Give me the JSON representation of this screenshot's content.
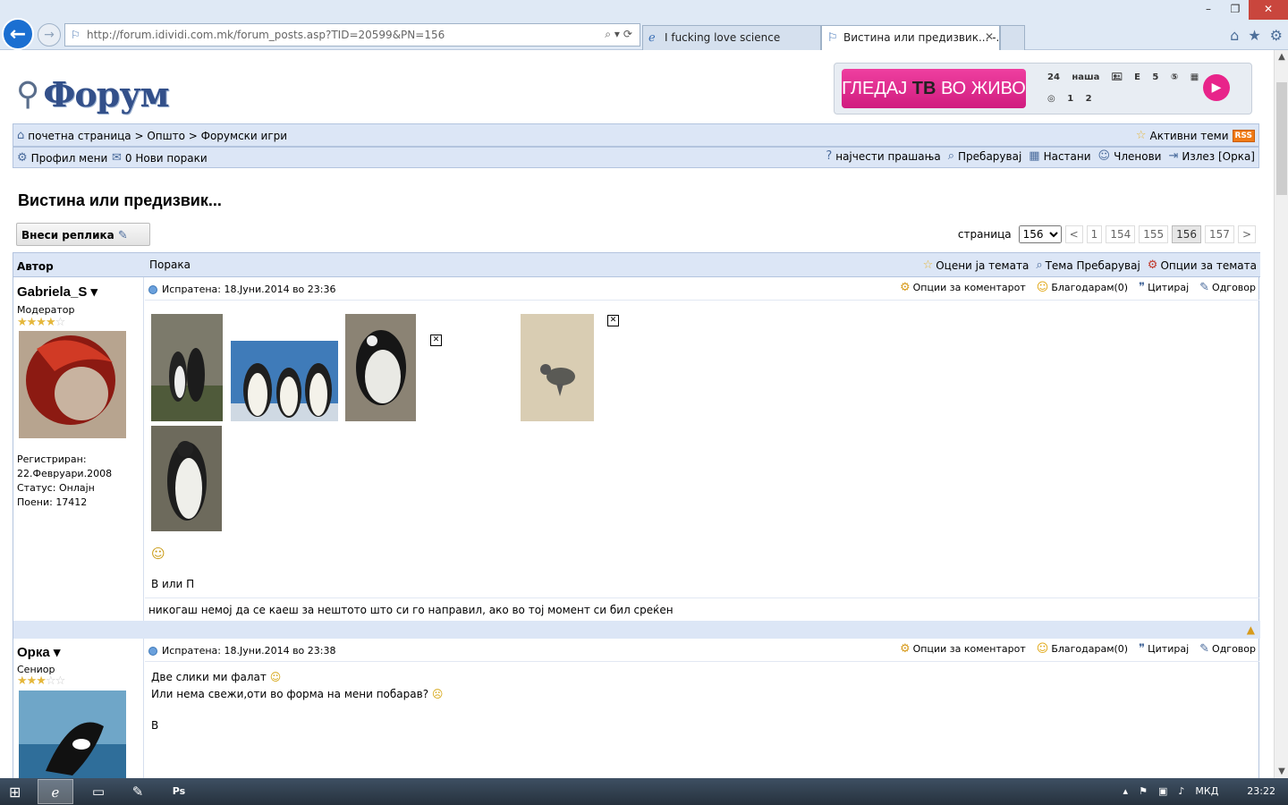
{
  "browser": {
    "url": "http://forum.idividi.com.mk/forum_posts.asp?TID=20599&PN=156",
    "tabs": [
      {
        "title": "I fucking love science"
      },
      {
        "title": "Вистина или предизвик... -..."
      }
    ],
    "win_controls": [
      "–",
      "❐",
      "✕"
    ]
  },
  "site": {
    "logo_text": "Форум",
    "banner": {
      "text_a": "ГЛЕДАЈ ",
      "text_tv": "ТВ",
      "text_b": " ВО ЖИВО",
      "channels": "24 наша 🖭 E 5 ⑤ ▦ ◎ 1 2"
    }
  },
  "nav": {
    "breadcrumb": "почетна страница > Општо > Форумски игри",
    "active_topics": "Активни теми",
    "rss": "RSS",
    "profile_menu": "Профил мени",
    "new_messages": "0 Нови пораки",
    "faq": "најчести прашања",
    "search": "Пребарувај",
    "events": "Настани",
    "members": "Членови",
    "logout": "Излез [Орка]"
  },
  "topic": {
    "title": "Вистина или предизвик...",
    "reply_button": "Внеси реплика",
    "page_label": "страница",
    "page_select": "156",
    "pages": [
      "<",
      "1",
      "154",
      "155",
      "156",
      "157",
      ">"
    ]
  },
  "table": {
    "col_author": "Автор",
    "col_message": "Порака",
    "rate_topic": "Оцени ја темата",
    "topic_search": "Тема Пребарувај",
    "topic_options": "Опции за темата"
  },
  "posts": [
    {
      "author": "Gabriela_S",
      "rank": "Модератор",
      "stars_filled": 4,
      "registered_label": "Регистриран:",
      "registered_date": "22.Февруари.2008",
      "status": "Статус: Онлајн",
      "points": "Поени: 17412",
      "posted": "Испратена: 18.Јуни.2014 во 23:36",
      "options": "Опции за коментарот",
      "thanks": "Благодарам(0)",
      "quote": "Цитирај",
      "reply": "Одговор",
      "body": "В или П",
      "signature": "никогаш немој да се каеш за нештото што си го направил, ако во тој момент си бил среќен"
    },
    {
      "author": "Орка",
      "rank": "Сениор",
      "stars_filled": 3,
      "posted": "Испратена: 18.Јуни.2014 во 23:38",
      "options": "Опции за коментарот",
      "thanks": "Благодарам(0)",
      "quote": "Цитирај",
      "reply": "Одговор",
      "line1": "Две слики ми фалат",
      "line2": "Или нема свежи,оти во форма на мени побарав?",
      "line3": "В"
    }
  ],
  "taskbar": {
    "lang": "МКД",
    "time": "23:22"
  }
}
